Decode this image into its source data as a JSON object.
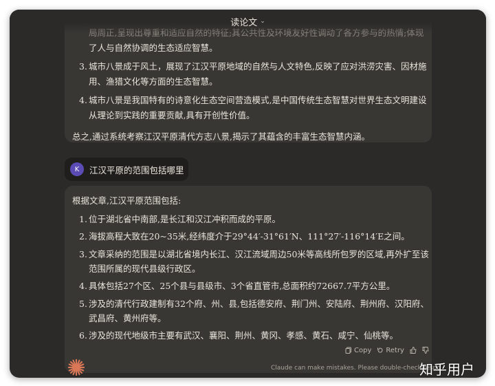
{
  "title": "读论文",
  "prev_response": {
    "lines": [
      "局周正,呈现出尊重和适应自然的特征;其公共性及环境友好性调动了各方参与的热情;体现",
      "了人与自然协调的生态适应智慧。"
    ],
    "items": [
      {
        "num": "3.",
        "lines": [
          "城市八景成于风土，展现了江汉平原地域的自然与人文特色,反映了应对洪涝灾害、因材施",
          "用、渔猎文化等方面的生态智慧。"
        ]
      },
      {
        "num": "4.",
        "lines": [
          "城市八景是我国特有的诗意化生态空间营造模式,是中国传统生态智慧对世界生态文明建设",
          "从理论到实践的重要贡献,具有开创性价值。"
        ]
      }
    ],
    "summary": "总之,通过系统考察江汉平原清代方志八景,揭示了其蕴含的丰富生态智慧内涵。"
  },
  "user_message": {
    "avatar": "K",
    "text": "江汉平原的范围包括哪里"
  },
  "response": {
    "intro": "根据文章,江汉平原范围包括:",
    "items": [
      {
        "num": "1.",
        "lines": [
          "位于湖北省中南部,是长江和汉江冲积而成的平原。"
        ]
      },
      {
        "num": "2.",
        "lines": [
          "海拔高程大致在20~35米,经纬度介于29°44′-31°61′N、111°27′-116°14′E之间。"
        ]
      },
      {
        "num": "3.",
        "lines": [
          "文章采纳的范围是以湖北省境内长江、汉江流域周边50米等高线所包罗的区域,再外扩至该",
          "范围所属的现代县级行政区。"
        ]
      },
      {
        "num": "4.",
        "lines": [
          "具体包括27个区、25个县与县级市、3个省直管市,总面积约72667.7平方公里。"
        ]
      },
      {
        "num": "5.",
        "lines": [
          "涉及的清代行政建制有32个府、州、县,包括德安府、荆门州、安陆府、荆州府、汉阳府、",
          "武昌府、黄州府等。"
        ]
      },
      {
        "num": "6.",
        "lines": [
          "涉及的现代地级市主要有武汉、襄阳、荆州、黄冈、孝感、黄石、咸宁、仙桃等。"
        ]
      }
    ]
  },
  "actions": {
    "copy": "Copy",
    "retry": "Retry"
  },
  "disclaimer": "Claude can make mistakes. Please double-check respo",
  "watermark": "知乎用户",
  "colors": {
    "window_bg": "#2b2a28",
    "card_bg": "#383734",
    "avatar_bg": "#5b4bb5",
    "logo": "#d97757"
  }
}
